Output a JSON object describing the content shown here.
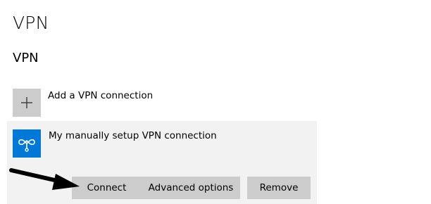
{
  "page": {
    "title": "VPN"
  },
  "vpn_section": {
    "heading": "VPN",
    "add_connection": {
      "icon": "plus-icon",
      "label": "Add a VPN connection"
    },
    "connection": {
      "icon": "vpn-connection-icon",
      "name": "My manually setup VPN connection",
      "buttons": {
        "connect": "Connect",
        "advanced": "Advanced options",
        "remove": "Remove"
      }
    }
  },
  "colors": {
    "accent": "#0078d7",
    "tile_gray": "#cccccc",
    "panel_bg": "#f2f2f2",
    "annotation_arrow": "#000000"
  }
}
